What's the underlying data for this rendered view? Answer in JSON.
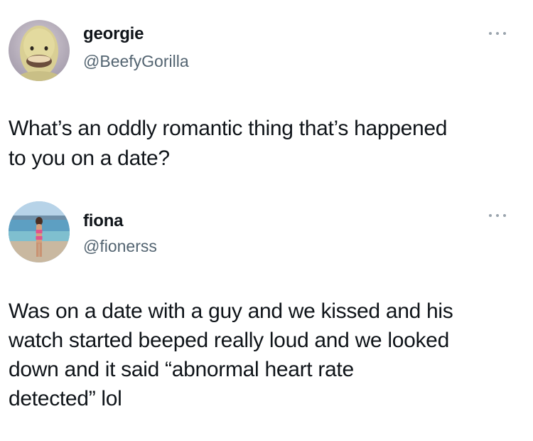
{
  "tweets": [
    {
      "display_name": "georgie",
      "handle": "@BeefyGorilla",
      "text": "What’s an oddly romantic thing that’s happened\nto you on a date?",
      "avatar_icon": "duck-face-avatar-icon",
      "more_icon": "more-options-icon"
    },
    {
      "display_name": "fiona",
      "handle": "@fionerss",
      "text": "Was on a date with a guy and we kissed and his\nwatch started beeped really loud and we looked\ndown and it said “abnormal heart rate\ndetected” lol",
      "avatar_icon": "beach-photo-avatar-icon",
      "more_icon": "more-options-icon"
    }
  ],
  "colors": {
    "text": "#0f1419",
    "secondary_text": "#536471",
    "more_dots": "#9aa4ad",
    "background": "#ffffff"
  }
}
